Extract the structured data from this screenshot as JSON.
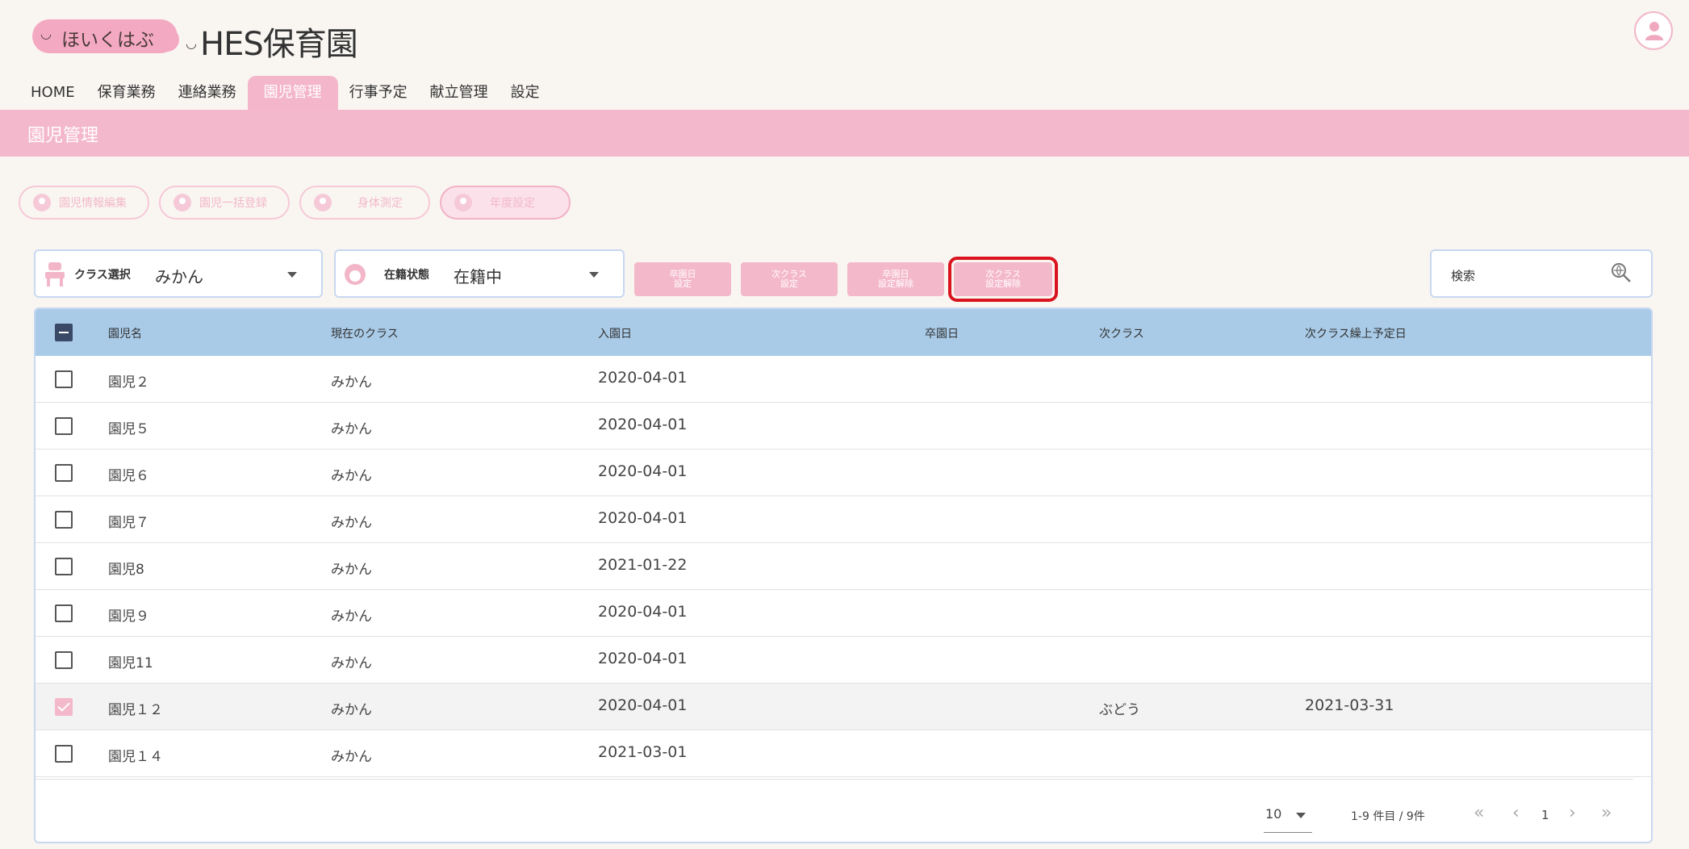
{
  "header": {
    "logo_text": "ほいくはぶ",
    "site_title": "HES保育園"
  },
  "nav": {
    "items": [
      "HOME",
      "保育業務",
      "連絡業務",
      "園児管理",
      "行事予定",
      "献立管理",
      "設定"
    ],
    "active": "園児管理"
  },
  "page": {
    "title": "園児管理"
  },
  "functions": {
    "buttons": [
      "園児情報編集",
      "園児一括登録",
      "身体測定",
      "年度設定"
    ],
    "selected": "年度設定"
  },
  "filters": {
    "class_label": "クラス選択",
    "class_value": "みかん",
    "status_label": "在籍状態",
    "status_value": "在籍中"
  },
  "actions": {
    "graduation_set": [
      "卒園日",
      "設定"
    ],
    "next_class_set": [
      "次クラス",
      "設定"
    ],
    "graduation_clear": [
      "卒園日",
      "設定解除"
    ],
    "next_class_clear": [
      "次クラス",
      "設定解除"
    ]
  },
  "search": {
    "placeholder": "検索"
  },
  "table": {
    "headers": [
      "園児名",
      "現在のクラス",
      "入園日",
      "卒園日",
      "次クラス",
      "次クラス繰上予定日"
    ],
    "rows": [
      {
        "name": "園児２",
        "class": "みかん",
        "enrolled": "2020-04-01",
        "graduated": "",
        "next_class": "",
        "next_date": "",
        "checked": false
      },
      {
        "name": "園児５",
        "class": "みかん",
        "enrolled": "2020-04-01",
        "graduated": "",
        "next_class": "",
        "next_date": "",
        "checked": false
      },
      {
        "name": "園児６",
        "class": "みかん",
        "enrolled": "2020-04-01",
        "graduated": "",
        "next_class": "",
        "next_date": "",
        "checked": false
      },
      {
        "name": "園児７",
        "class": "みかん",
        "enrolled": "2020-04-01",
        "graduated": "",
        "next_class": "",
        "next_date": "",
        "checked": false
      },
      {
        "name": "園児8",
        "class": "みかん",
        "enrolled": "2021-01-22",
        "graduated": "",
        "next_class": "",
        "next_date": "",
        "checked": false
      },
      {
        "name": "園児９",
        "class": "みかん",
        "enrolled": "2020-04-01",
        "graduated": "",
        "next_class": "",
        "next_date": "",
        "checked": false
      },
      {
        "name": "園児11",
        "class": "みかん",
        "enrolled": "2020-04-01",
        "graduated": "",
        "next_class": "",
        "next_date": "",
        "checked": false
      },
      {
        "name": "園児１２",
        "class": "みかん",
        "enrolled": "2020-04-01",
        "graduated": "",
        "next_class": "ぶどう",
        "next_date": "2021-03-31",
        "checked": true
      },
      {
        "name": "園児１４",
        "class": "みかん",
        "enrolled": "2021-03-01",
        "graduated": "",
        "next_class": "",
        "next_date": "",
        "checked": false
      }
    ]
  },
  "pagination": {
    "per_page": "10",
    "range_text": "1-9 件目 / 9件",
    "current_page": "1"
  },
  "colors": {
    "accent_pink": "#f4b8cb",
    "table_header_blue": "#a9cbe8",
    "highlight_red": "#d9141e"
  }
}
